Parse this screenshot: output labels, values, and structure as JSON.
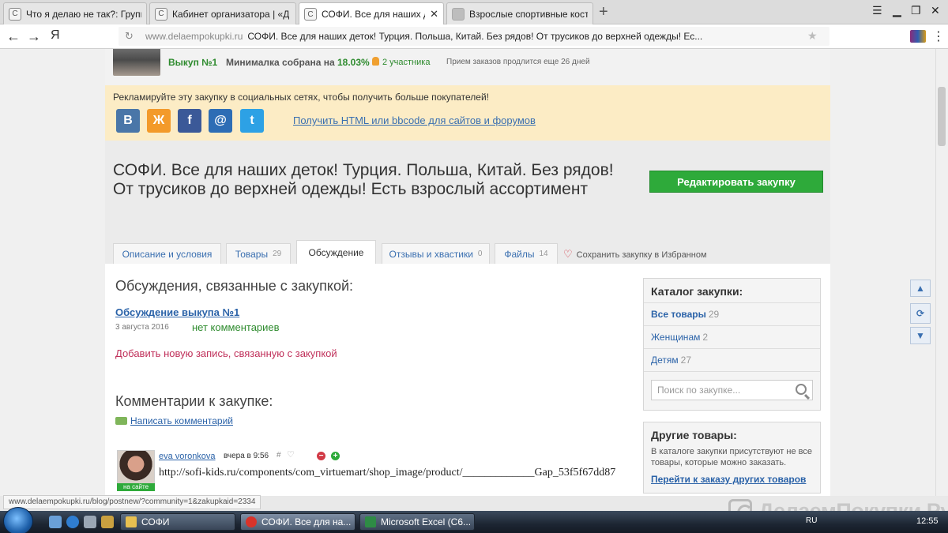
{
  "browser": {
    "tabs": [
      {
        "title": "Что я делаю не так?: Групп"
      },
      {
        "title": "Кабинет организатора | «Д"
      },
      {
        "title": "СОФИ. Все для наших де"
      },
      {
        "title": "Взрослые спортивные кост"
      }
    ],
    "address": {
      "host": "www.delaempokupki.ru",
      "page_title": "СОФИ. Все для наших деток! Турция. Польша, Китай. Без рядов! От трусиков до верхней одежды! Ес..."
    },
    "yandex_glyph": "Я",
    "status_url": "www.delaempokupki.ru/blog/postnew/?community=1&zakupkaid=2334"
  },
  "purchase": {
    "vykup": "Выкуп №1",
    "min_label": "Минималка собрана на",
    "min_pct": "18.03%",
    "participants": "2 участника",
    "orders_info": "Прием заказов продлится еще 26 дней"
  },
  "promo": {
    "text": "Рекламируйте эту закупку в социальных сетях, чтобы получить больше покупателей!",
    "html_link": "Получить HTML или bbcode для сайтов и форумов",
    "vk_glyph": "В",
    "ok_glyph": "Ж",
    "fb_glyph": "f",
    "mail_glyph": "@",
    "tw_glyph": "t"
  },
  "header": {
    "title": "СОФИ. Все для наших деток! Турция. Польша, Китай. Без рядов! От трусиков до верхней одежды! Есть взрослый ассортимент",
    "edit_button": "Редактировать закупку"
  },
  "tabs": [
    {
      "label": "Описание и условия",
      "count": ""
    },
    {
      "label": "Товары",
      "count": "29"
    },
    {
      "label": "Обсуждение",
      "count": ""
    },
    {
      "label": "Отзывы и хвастики",
      "count": "0"
    },
    {
      "label": "Файлы",
      "count": "14"
    }
  ],
  "save_fav": "Сохранить закупку в Избранном",
  "discussions": {
    "heading": "Обсуждения, связанные с закупкой:",
    "item_title": "Обсуждение выкупа №1",
    "item_date": "3 августа 2016",
    "item_comments": "нет комментариев",
    "add_link": "Добавить новую запись, связанную с закупкой"
  },
  "comments": {
    "heading": "Комментарии к закупке:",
    "write_link": "Написать комментарий",
    "online_label": "на сайте",
    "entry": {
      "user": "eva voronkova",
      "time": "вчера в 9:56",
      "hash": "#",
      "text": "http://sofi-kids.ru/components/com_virtuemart/shop_image/product/_____________Gap_53f5f67dd87"
    }
  },
  "catalog": {
    "title": "Каталог закупки:",
    "items": [
      {
        "label": "Все товары",
        "count": "29"
      },
      {
        "label": "Женщинам",
        "count": "2"
      },
      {
        "label": "Детям",
        "count": "27"
      }
    ],
    "search_placeholder": "Поиск по закупке..."
  },
  "other": {
    "title": "Другие товары:",
    "text": "В каталоге закупки присутствуют не все товары, которые можно заказать.",
    "link": "Перейти к заказу других товаров"
  },
  "watermark": "ДелаемПокупки.Ру",
  "taskbar": {
    "tasks": [
      {
        "label": "СОФИ"
      },
      {
        "label": "СОФИ. Все для на..."
      },
      {
        "label": "Microsoft Excel (C6..."
      }
    ],
    "lang": "RU",
    "clock": "12:55"
  }
}
